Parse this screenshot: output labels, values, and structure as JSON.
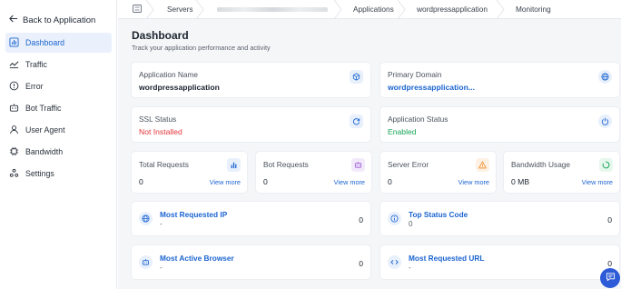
{
  "sidebar": {
    "back_label": "Back to Application",
    "items": [
      {
        "label": "Dashboard",
        "icon": "bar-chart-icon",
        "active": true
      },
      {
        "label": "Traffic",
        "icon": "trend-icon"
      },
      {
        "label": "Error",
        "icon": "alert-circle-icon"
      },
      {
        "label": "Bot Traffic",
        "icon": "robot-icon"
      },
      {
        "label": "User Agent",
        "icon": "user-icon"
      },
      {
        "label": "Bandwidth",
        "icon": "chip-icon"
      },
      {
        "label": "Settings",
        "icon": "settings-icon"
      }
    ]
  },
  "breadcrumb": {
    "items": [
      "Servers",
      "Applications",
      "wordpressapplication",
      "Monitoring"
    ]
  },
  "page": {
    "title": "Dashboard",
    "subtitle": "Track your application performance and activity"
  },
  "info_cards": {
    "app_name": {
      "label": "Application Name",
      "value": "wordpressapplication",
      "icon": "cube-icon"
    },
    "primary_domain": {
      "label": "Primary Domain",
      "value": "wordpressapplication...",
      "icon": "globe-icon"
    },
    "ssl_status": {
      "label": "SSL Status",
      "value": "Not Installed",
      "icon": "refresh-icon"
    },
    "app_status": {
      "label": "Application Status",
      "value": "Enabled",
      "icon": "power-icon"
    }
  },
  "stat_cards": {
    "total_requests": {
      "label": "Total Requests",
      "value": "0",
      "link": "View more",
      "icon": "bar-chart-icon"
    },
    "bot_requests": {
      "label": "Bot Requests",
      "value": "0",
      "link": "View more",
      "icon": "robot-icon"
    },
    "server_error": {
      "label": "Server Error",
      "value": "0",
      "link": "View more",
      "icon": "warning-icon"
    },
    "bandwidth_usage": {
      "label": "Bandwidth Usage",
      "value": "0 MB",
      "link": "View more",
      "icon": "circle-progress-icon"
    }
  },
  "list_cards": {
    "most_requested_ip": {
      "title": "Most Requested IP",
      "sub": "-",
      "count": "0",
      "icon": "globe-icon"
    },
    "top_status_code": {
      "title": "Top Status Code",
      "sub": "0",
      "count": "0",
      "icon": "info-icon"
    },
    "most_active_browser": {
      "title": "Most Active Browser",
      "sub": "-",
      "count": "0",
      "icon": "robot-icon"
    },
    "most_requested_url": {
      "title": "Most Requested URL",
      "sub": "-",
      "count": "0",
      "icon": "code-icon"
    }
  },
  "colors": {
    "accent": "#1b64d0",
    "error": "#e5343a",
    "success": "#18a558",
    "chat_button": "#2d5bd7"
  }
}
